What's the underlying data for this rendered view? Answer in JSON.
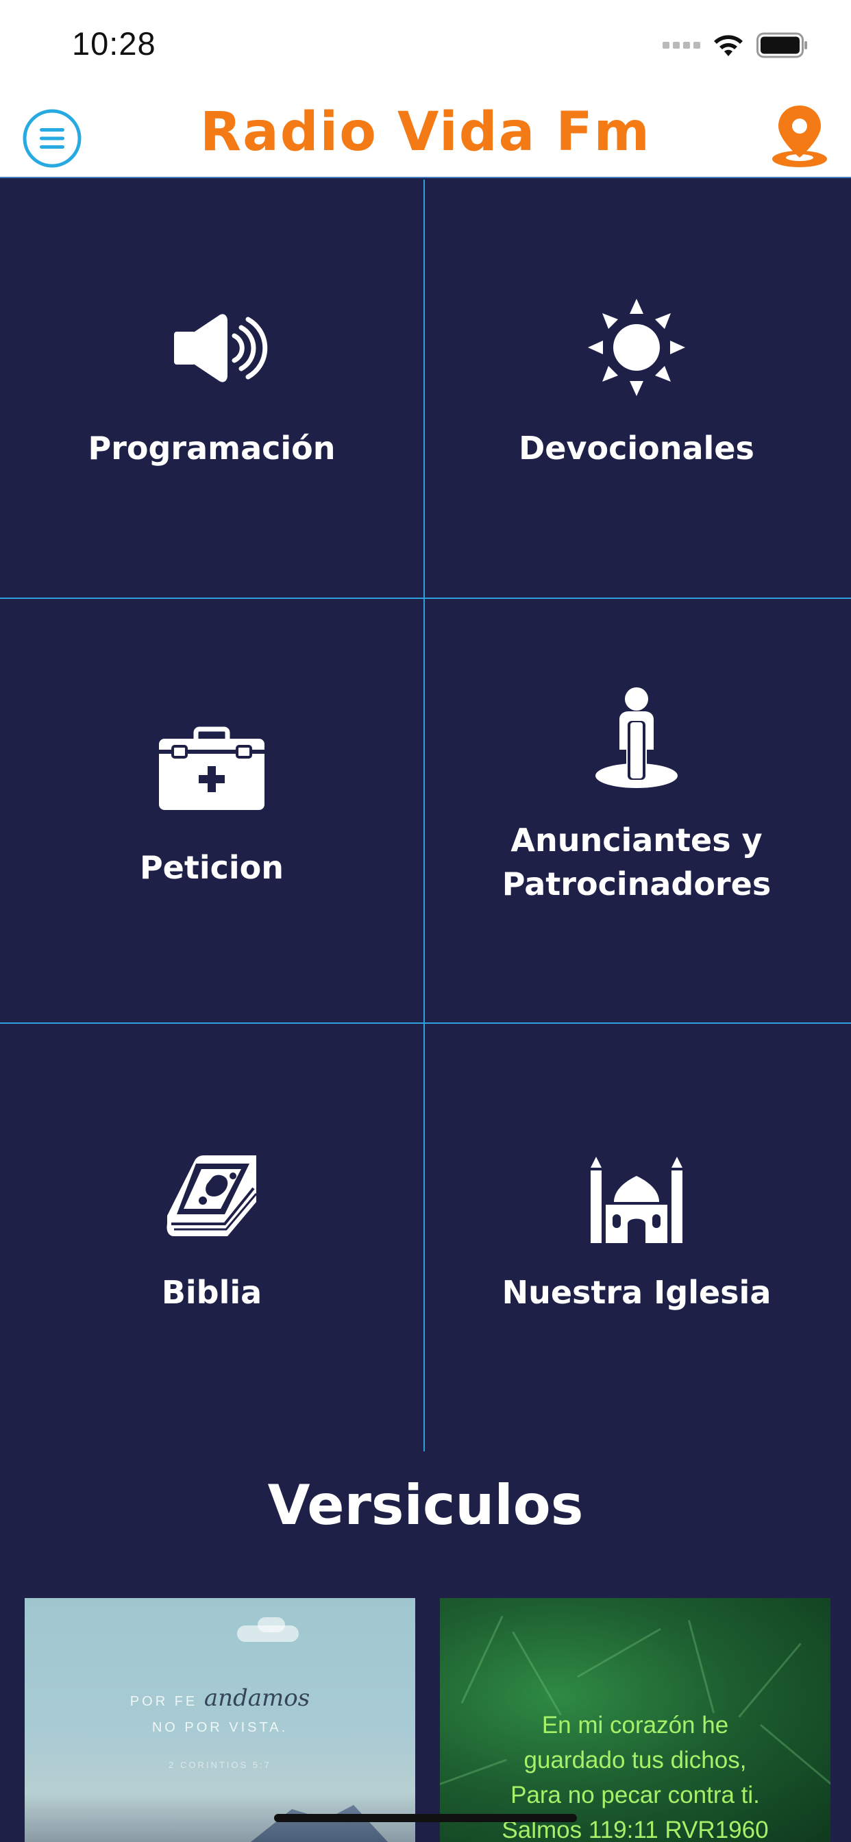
{
  "status_bar": {
    "time": "10:28"
  },
  "navbar": {
    "title": "Radio Vida Fm"
  },
  "grid": {
    "tiles": [
      {
        "label": "Programación",
        "icon": "speaker-icon"
      },
      {
        "label": "Devocionales",
        "icon": "sun-icon"
      },
      {
        "label": "Peticion",
        "icon": "first-aid-kit-icon"
      },
      {
        "label": "Anunciantes y\nPatrocinadores",
        "icon": "person-standing-icon"
      },
      {
        "label": "Biblia",
        "icon": "bible-icon"
      },
      {
        "label": "Nuestra Iglesia",
        "icon": "church-icon"
      }
    ]
  },
  "versiculos": {
    "title": "Versiculos",
    "cards": [
      {
        "line1_prefix": "POR FE",
        "line1_script": "andamos",
        "line2": "NO POR VISTA.",
        "reference": "2 CORINTIOS 5:7"
      },
      {
        "text": "En mi corazón he\nguardado tus dichos,\nPara no pecar contra ti.\nSalmos 119:11 RVR1960"
      }
    ]
  },
  "colors": {
    "background": "#1e2048",
    "accent": "#f47a16",
    "divider": "#2f9fe0",
    "menu_icon": "#27a9e1",
    "verse_green": "#a6f06a"
  }
}
